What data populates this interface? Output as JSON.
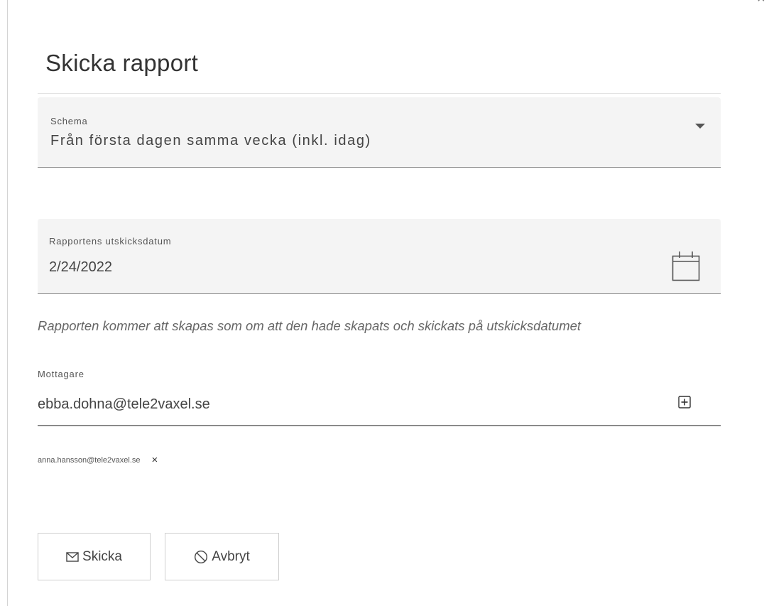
{
  "dialog": {
    "title": "Skicka rapport",
    "close_glyph": "×"
  },
  "schedule": {
    "label": "Schema",
    "value": "Från första dagen samma vecka (inkl. idag)",
    "icon": "dropdown-arrow-icon"
  },
  "send_date": {
    "label": "Rapportens utskicksdatum",
    "value": "2/24/2022",
    "icon": "calendar-icon"
  },
  "hint": "Rapporten kommer att skapas som om att den hade skapats och skickats på utskicksdatumet",
  "recipients": {
    "label": "Mottagare",
    "input_value": "ebba.dohna@tele2vaxel.se",
    "add_icon": "add-box-icon",
    "chips": [
      {
        "email": "anna.hansson@tele2vaxel.se",
        "remove_glyph": "×"
      }
    ]
  },
  "actions": {
    "send_label": "Skicka",
    "send_icon": "mail-icon",
    "cancel_label": "Avbryt",
    "cancel_icon": "block-icon"
  }
}
